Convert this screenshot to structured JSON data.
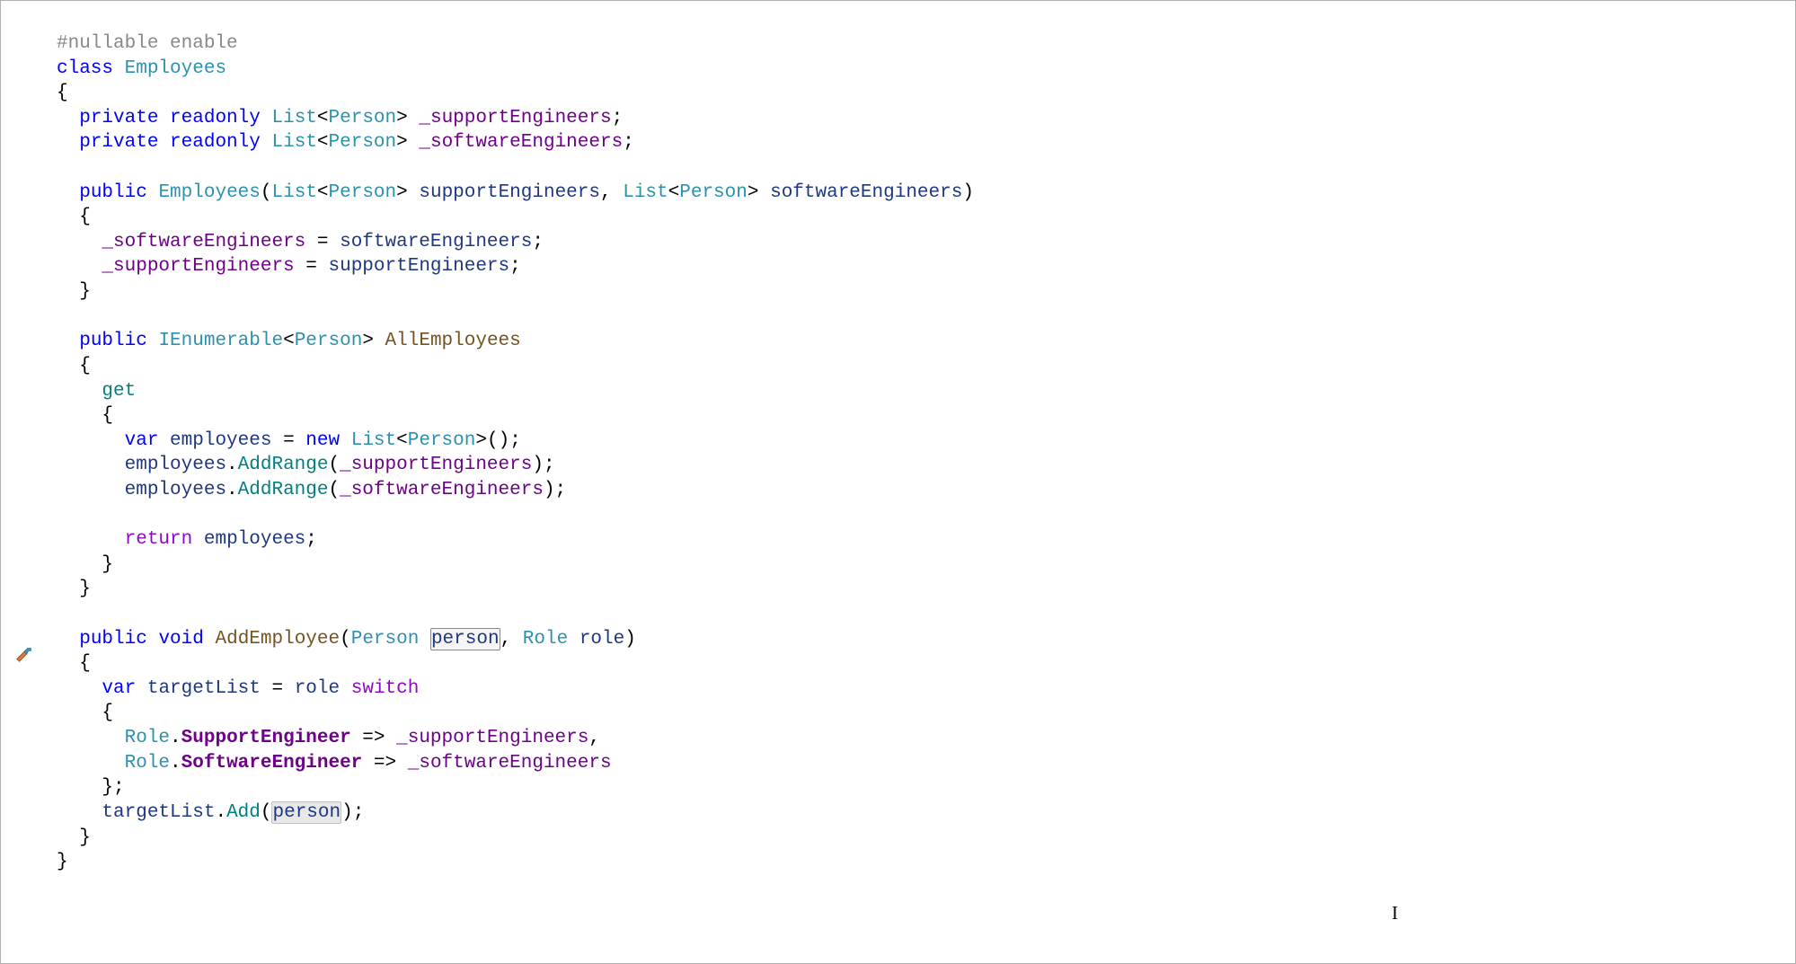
{
  "icon": {
    "hammer_name": "hammer-icon"
  },
  "code": {
    "l1_directive": "#nullable enable",
    "l2_kw_class": "class",
    "l2_type": "Employees",
    "l3_brace": "{",
    "l4_kw_private": "private",
    "l4_kw_readonly": "readonly",
    "l4_type_list": "List",
    "l4_type_person": "Person",
    "l4_field": "_supportEngineers",
    "l5_field": "_softwareEngineers",
    "l7_kw_public": "public",
    "l7_ctor": "Employees",
    "l7_param1": "supportEngineers",
    "l7_param2": "softwareEngineers",
    "l8_brace": "{",
    "l9_lhs": "_softwareEngineers",
    "l9_rhs": "softwareEngineers",
    "l10_lhs": "_supportEngineers",
    "l10_rhs": "supportEngineers",
    "l11_brace": "}",
    "l13_type_ienum": "IEnumerable",
    "l13_prop": "AllEmployees",
    "l15_kw_get": "get",
    "l17_kw_var": "var",
    "l17_local": "employees",
    "l17_kw_new": "new",
    "l18_method": "AddRange",
    "l21_kw_return": "return",
    "l25_kw_void": "void",
    "l25_method": "AddEmployee",
    "l25_type_role": "Role",
    "l25_param_person": "person",
    "l25_param_role": "role",
    "l27_local": "targetList",
    "l27_kw_switch": "switch",
    "l29_enum_prefix": "Role",
    "l29_enum_support": "SupportEngineer",
    "l30_enum_software": "SoftwareEngineer",
    "l32_method_add": "Add",
    "arrow": "=>",
    "semicolon": ";",
    "comma": ",",
    "dot": ".",
    "lt": "<",
    "gt": ">",
    "lparen": "(",
    "rparen": ")",
    "lbrace": "{",
    "rbrace": "}",
    "equals": "=",
    "empty_parens": "()"
  },
  "cursor_text": "I"
}
